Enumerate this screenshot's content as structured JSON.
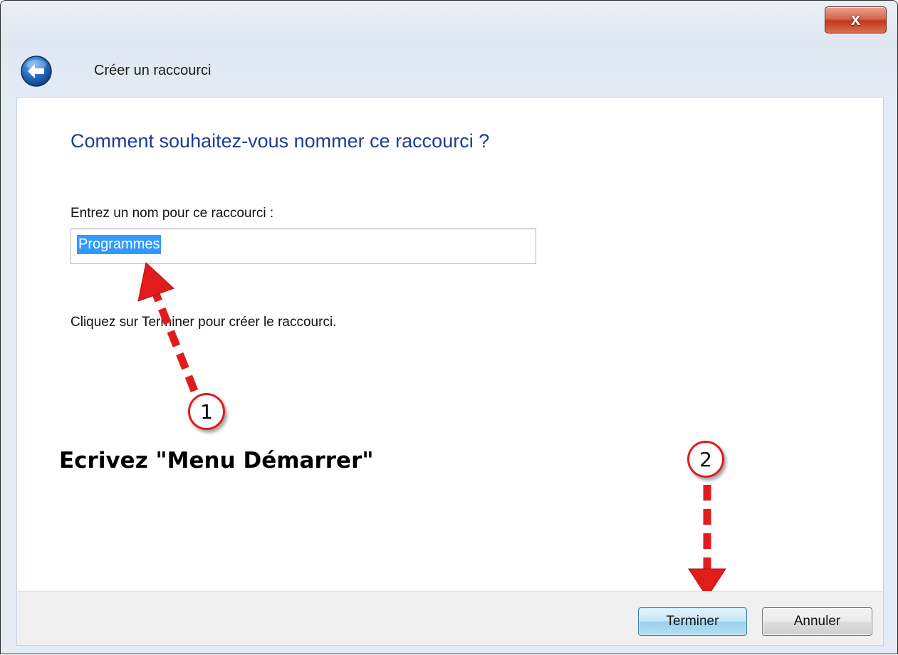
{
  "window": {
    "title": "Créer un raccourci",
    "close_glyph": "x"
  },
  "page": {
    "heading": "Comment souhaitez-vous nommer ce raccourci ?",
    "field_label": "Entrez un nom pour ce raccourci :",
    "name_value": "Programmes",
    "hint": "Cliquez sur Terminer pour créer le raccourci."
  },
  "annotations": {
    "step1_number": "1",
    "step1_text": "Ecrivez \"Menu Démarrer\"",
    "step2_number": "2",
    "arrow_color": "#e21b1b"
  },
  "footer": {
    "finish_label": "Terminer",
    "cancel_label": "Annuler"
  },
  "icons": {
    "back": "back-arrow-icon",
    "close": "close-icon"
  },
  "colors": {
    "heading": "#1b3d9a",
    "selection": "#3399ff",
    "close_button": "#c0391c"
  }
}
